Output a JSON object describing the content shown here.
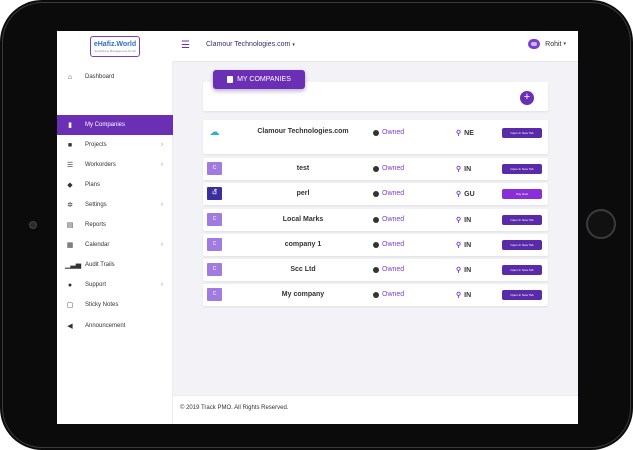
{
  "brand": {
    "logo_text": "eHafiz.World",
    "logo_sub": "Simplifying Management for All"
  },
  "header": {
    "company_selector": "Clamour Technologies.com",
    "user_name": "Rohit"
  },
  "sidebar": {
    "items": [
      {
        "label": "Dashboard",
        "icon": "home-icon",
        "submenu": false,
        "active": false
      },
      {
        "label": "My Companies",
        "icon": "building-icon",
        "submenu": false,
        "active": true
      },
      {
        "label": "Projects",
        "icon": "folder-icon",
        "submenu": true,
        "active": false
      },
      {
        "label": "Workorders",
        "icon": "list-icon",
        "submenu": true,
        "active": false
      },
      {
        "label": "Plans",
        "icon": "cube-icon",
        "submenu": false,
        "active": false
      },
      {
        "label": "Settings",
        "icon": "gear-icon",
        "submenu": true,
        "active": false
      },
      {
        "label": "Reports",
        "icon": "report-icon",
        "submenu": false,
        "active": false
      },
      {
        "label": "Calendar",
        "icon": "calendar-icon",
        "submenu": true,
        "active": false
      },
      {
        "label": "Audit Trails",
        "icon": "bar-chart-icon",
        "submenu": false,
        "active": false
      },
      {
        "label": "Support",
        "icon": "help-icon",
        "submenu": true,
        "active": false
      },
      {
        "label": "Sticky Notes",
        "icon": "note-icon",
        "submenu": false,
        "active": false
      },
      {
        "label": "Announcement",
        "icon": "megaphone-icon",
        "submenu": false,
        "active": false
      }
    ]
  },
  "main": {
    "title": "MY COMPANIES",
    "companies": [
      {
        "logo": "",
        "name": "Clamour Technologies.com",
        "status": "Owned",
        "location": "NE",
        "action": "Open In New Tab"
      },
      {
        "logo": "C",
        "name": "test",
        "status": "Owned",
        "location": "IN",
        "action": "Open In New Tab"
      },
      {
        "logo": "பீ",
        "name": "perl",
        "status": "Owned",
        "location": "GU",
        "action": "Pay Now"
      },
      {
        "logo": "C",
        "name": "Local Marks",
        "status": "Owned",
        "location": "IN",
        "action": "Open In New Tab"
      },
      {
        "logo": "C",
        "name": "company 1",
        "status": "Owned",
        "location": "IN",
        "action": "Open In New Tab"
      },
      {
        "logo": "C",
        "name": "Scc Ltd",
        "status": "Owned",
        "location": "IN",
        "action": "Open In New Tab"
      },
      {
        "logo": "C",
        "name": "My company",
        "status": "Owned",
        "location": "IN",
        "action": "Open In New Tab"
      }
    ]
  },
  "footer": {
    "text": "© 2019 Track PMO. All Rights Reserved."
  },
  "colors": {
    "accent": "#6a2fb5",
    "pay_button": "#8a2fd8",
    "background": "#f3f3f7"
  }
}
